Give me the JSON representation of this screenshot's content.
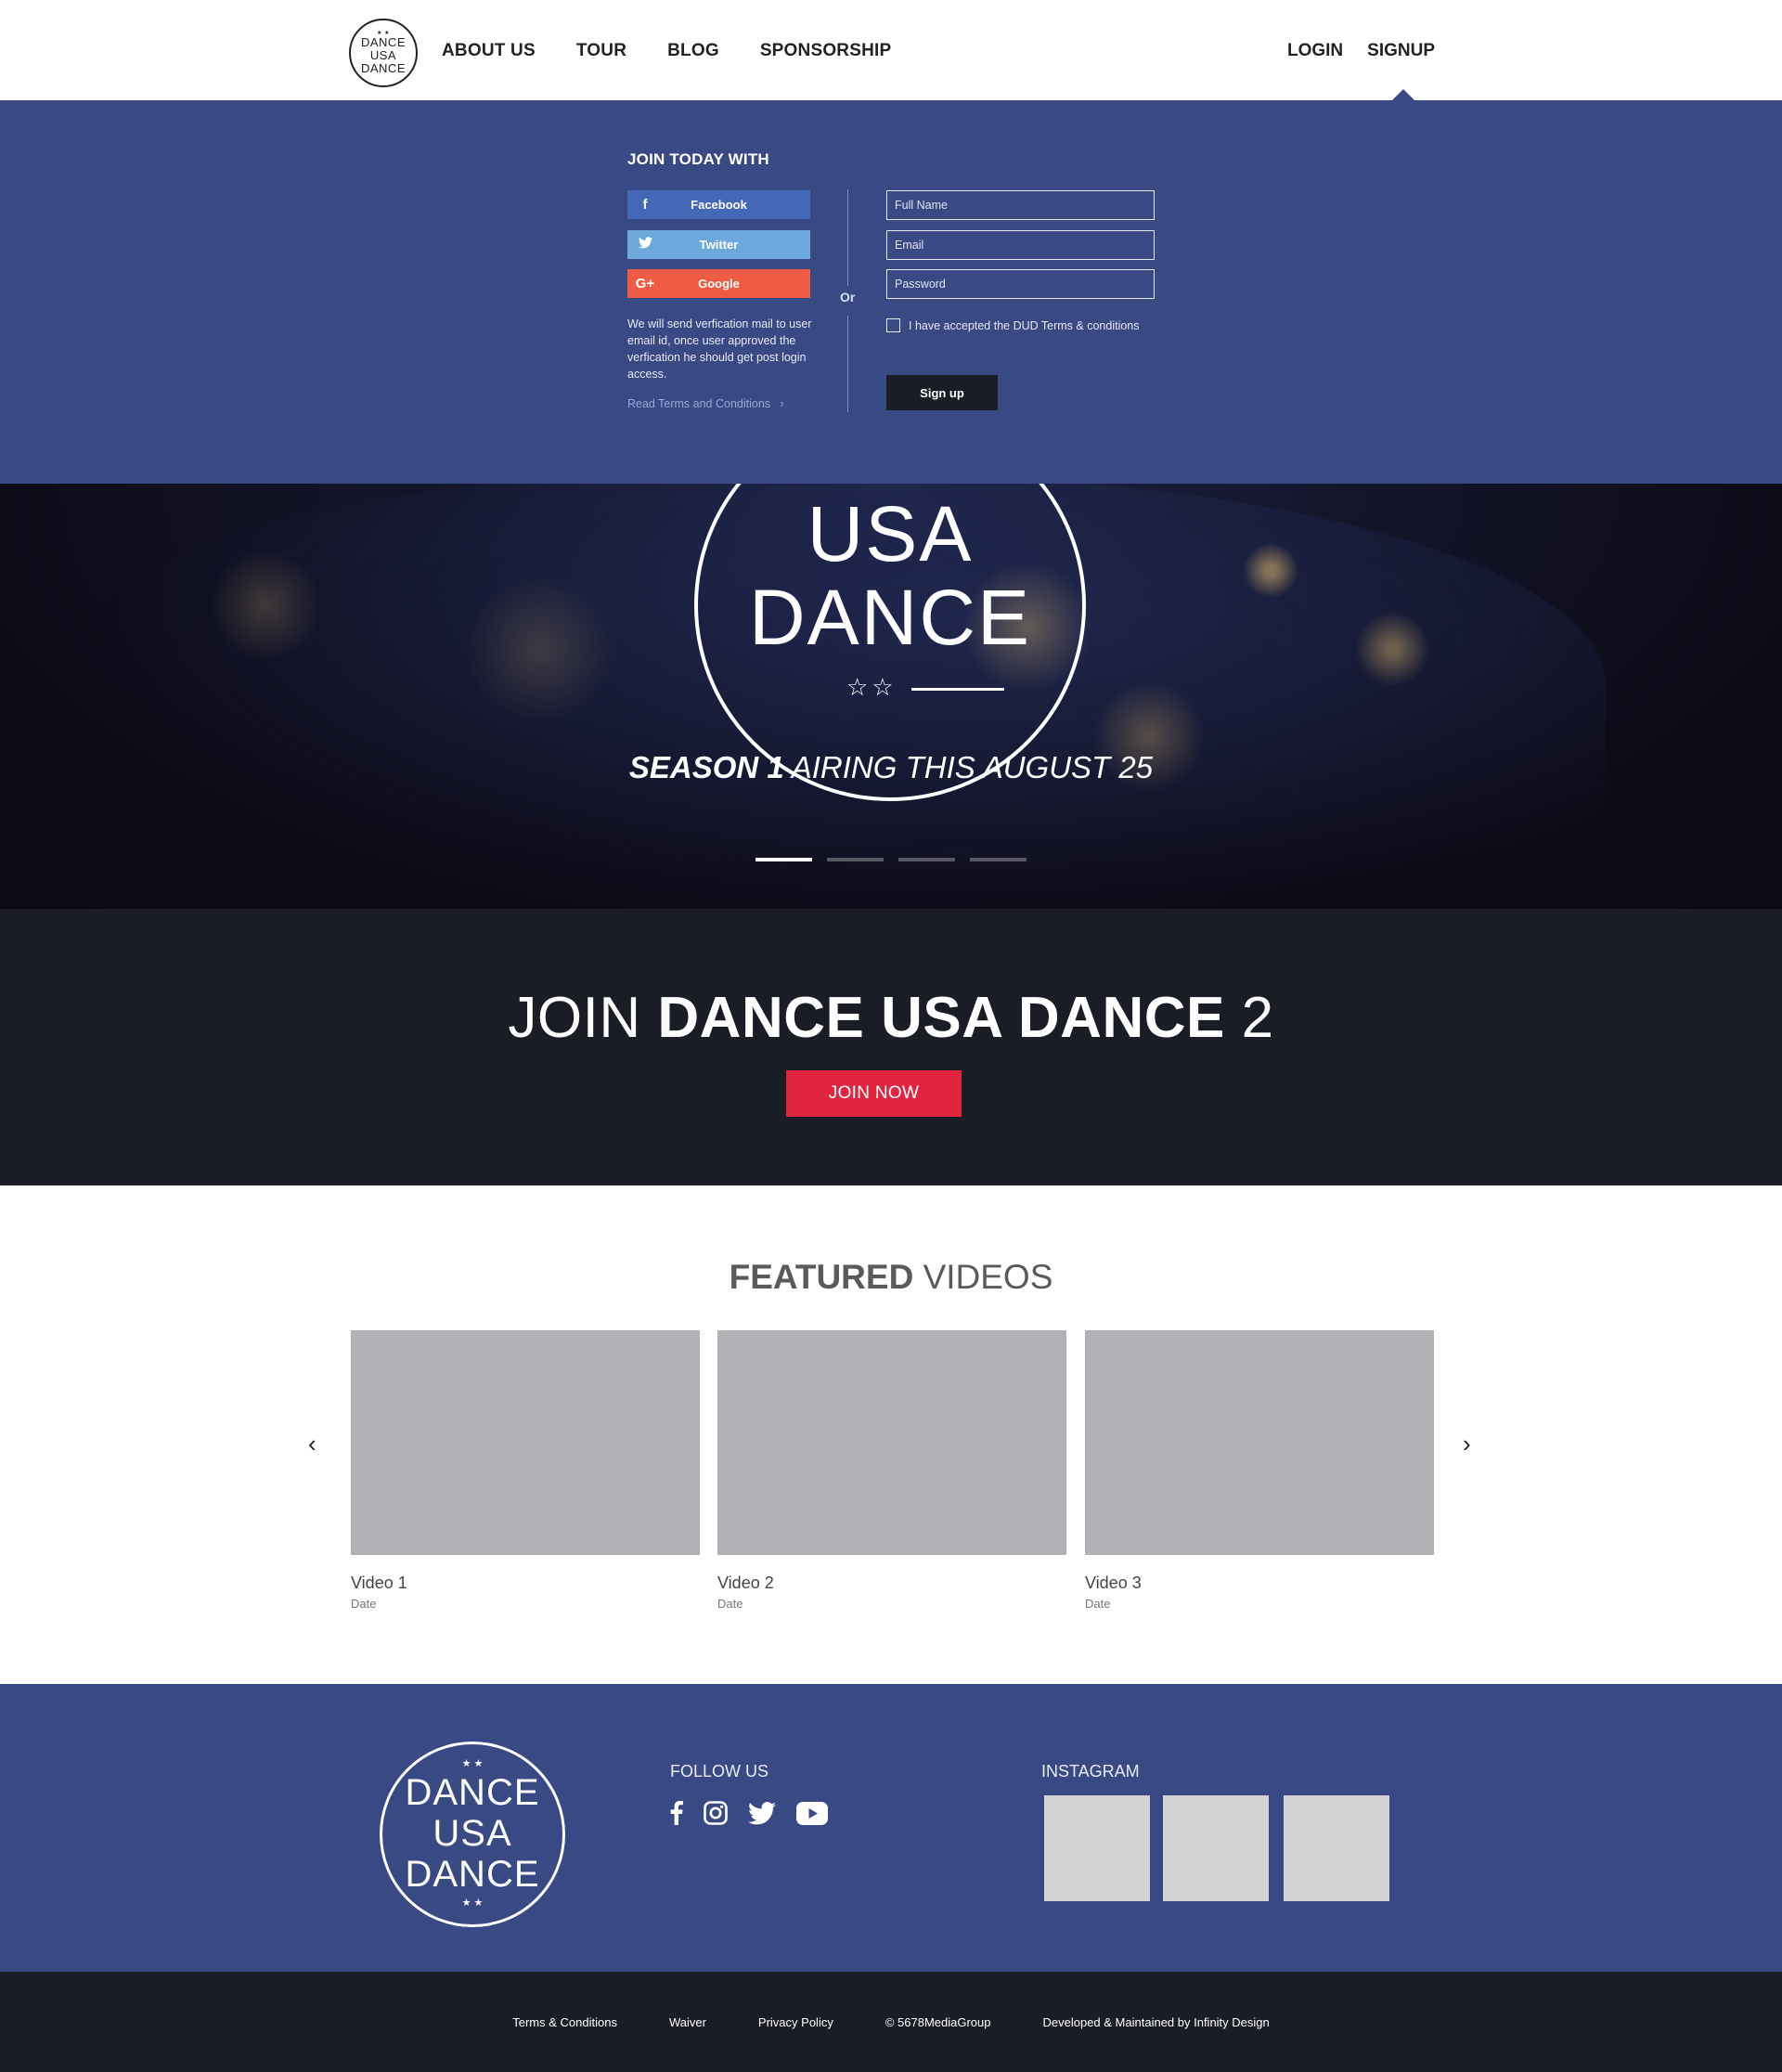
{
  "header": {
    "logo_text": [
      "DANCE",
      "USA",
      "DANCE"
    ],
    "nav": [
      "ABOUT US",
      "TOUR",
      "BLOG",
      "SPONSORSHIP"
    ],
    "login": "LOGIN",
    "signup": "SIGNUP"
  },
  "signup_panel": {
    "join_with": "JOIN TODAY WITH",
    "facebook": "Facebook",
    "twitter": "Twitter",
    "google": "Google",
    "verify_text": "We will send verfication mail to user email id, once user approved the verfication he should get post login access.",
    "terms_link": "Read Terms and Conditions",
    "or": "Or",
    "full_name_placeholder": "Full Name",
    "email_placeholder": "Email",
    "password_placeholder": "Password",
    "terms_check": "I have accepted the DUD Terms & conditions",
    "signup_button": "Sign up"
  },
  "hero": {
    "logo_line1": "USA",
    "logo_line2": "DANCE",
    "season": "SEASON 1",
    "airing": "AIRING THIS AUGUST 25",
    "slides": 4,
    "active_slide": 1
  },
  "join": {
    "prefix": "JOIN",
    "bold": "DANCE USA DANCE",
    "suffix": "2",
    "button": "JOIN NOW"
  },
  "featured": {
    "title_bold": "FEATURED",
    "title_rest": "VIDEOS",
    "videos": [
      {
        "title": "Video 1",
        "date": "Date"
      },
      {
        "title": "Video 2",
        "date": "Date"
      },
      {
        "title": "Video 3",
        "date": "Date"
      }
    ]
  },
  "footer": {
    "logo_text": [
      "DANCE",
      "USA",
      "DANCE"
    ],
    "follow_us": "FOLLOW US",
    "instagram": "INSTAGRAM",
    "social_icons": [
      "facebook-icon",
      "instagram-icon",
      "twitter-icon",
      "youtube-icon"
    ],
    "links": [
      "Terms & Conditions",
      "Waiver",
      "Privacy Policy",
      "© 5678MediaGroup",
      "Developed & Maintained by Infinity Design"
    ]
  },
  "colors": {
    "brand_blue": "#394984",
    "dark": "#1b1d26",
    "red": "#e1243f",
    "facebook": "#4468b5",
    "twitter": "#6da8dc",
    "google": "#ef5b44"
  }
}
